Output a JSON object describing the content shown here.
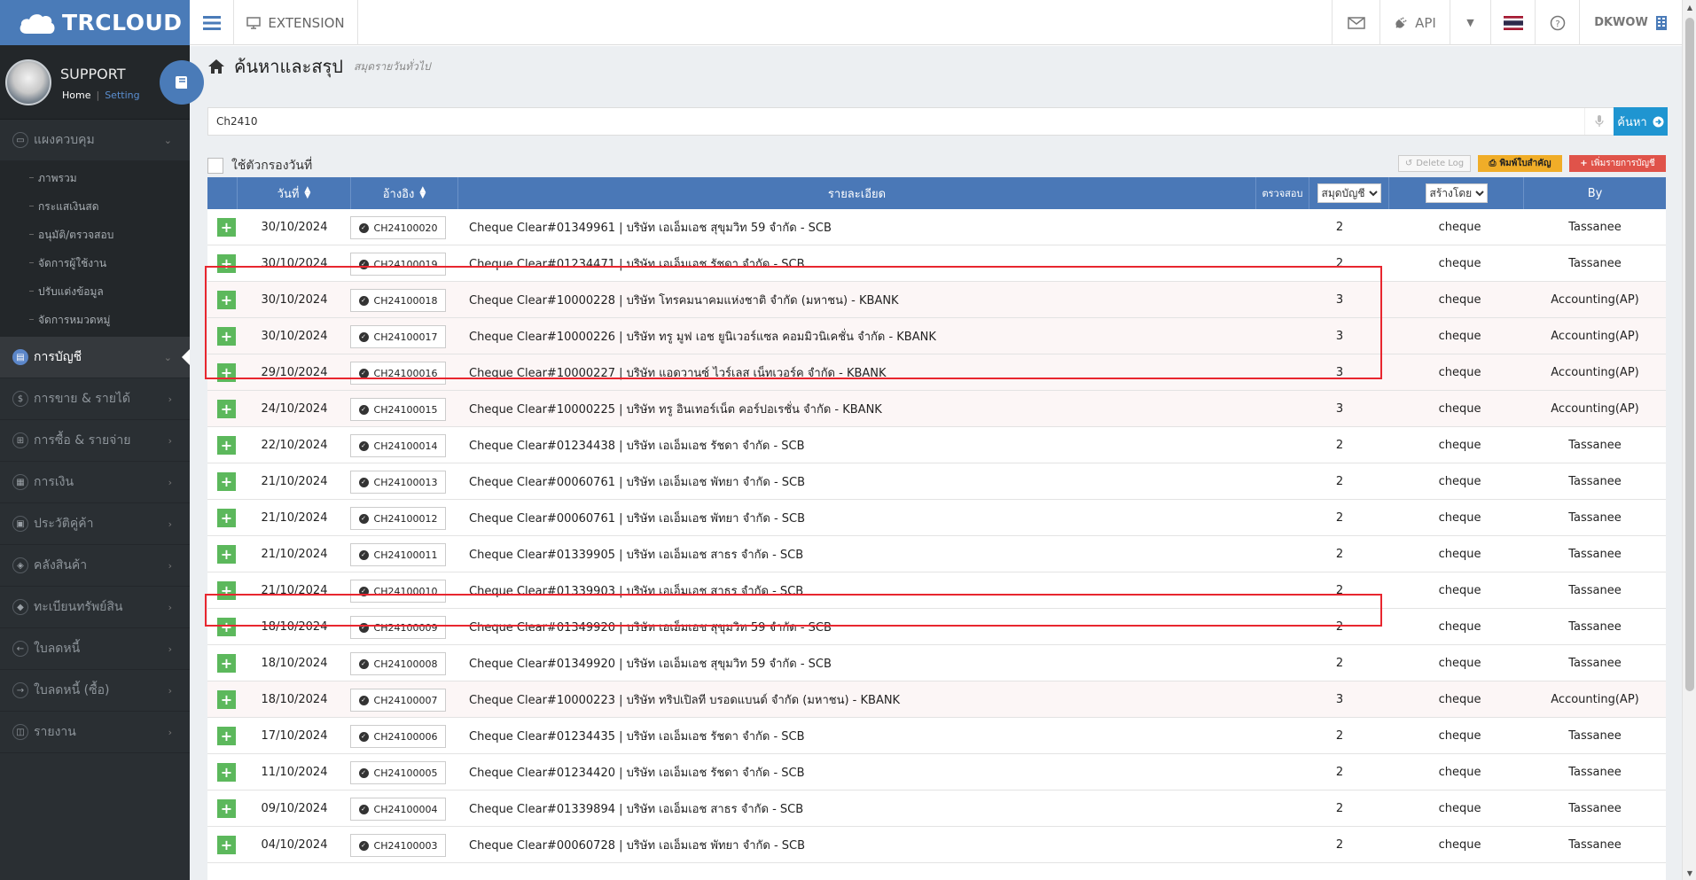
{
  "brand": {
    "name": "TRCLOUD"
  },
  "user": {
    "name": "SUPPORT",
    "home_link": "Home",
    "separator": "|",
    "setting_link": "Setting"
  },
  "topbar": {
    "extension_label": "EXTENSION",
    "api_label": "API",
    "company": "DKWOW"
  },
  "sidebar": {
    "dashboard": {
      "label": "แผงควบคุม",
      "sub": [
        "ภาพรวม",
        "กระแสเงินสด",
        "อนุมัติ/ตรวจสอบ",
        "จัดการผู้ใช้งาน",
        "ปรับแต่งข้อมูล",
        "จัดการหมวดหมู่"
      ]
    },
    "items": [
      {
        "label": "การบัญชี",
        "icon": "book-icon"
      },
      {
        "label": "การขาย & รายได้",
        "icon": "dollar-icon"
      },
      {
        "label": "การซื้อ & รายจ่าย",
        "icon": "cart-icon"
      },
      {
        "label": "การเงิน",
        "icon": "calendar-icon"
      },
      {
        "label": "ประวัติคู่ค้า",
        "icon": "contact-icon"
      },
      {
        "label": "คลังสินค้า",
        "icon": "boxes-icon"
      },
      {
        "label": "ทะเบียนทรัพย์สิน",
        "icon": "diamond-icon"
      },
      {
        "label": "ใบลดหนี้",
        "icon": "arrow-left-icon"
      },
      {
        "label": "ใบลดหนี้ (ซื้อ)",
        "icon": "arrow-right-icon"
      },
      {
        "label": "รายงาน",
        "icon": "report-icon"
      }
    ]
  },
  "page": {
    "title": "ค้นหาและสรุป",
    "subtitle": "สมุดรายวันทั่วไป"
  },
  "search": {
    "value": "Ch2410",
    "button": "ค้นหา"
  },
  "filter": {
    "label": "ใช้ตัวกรองวันที่"
  },
  "actions": {
    "delete_log": "Delete Log",
    "print": "พิมพ์ใบสำคัญ",
    "add": "เพิ่มรายการบัญชี"
  },
  "table": {
    "headers": {
      "date": "วันที่",
      "ref": "อ้างอิง",
      "detail": "รายละเอียด",
      "check": "ตรวจสอบ",
      "book_select": "สมุดบัญชี",
      "creator_select": "สร้างโดย",
      "by": "By"
    },
    "rows": [
      {
        "date": "30/10/2024",
        "ref": "CH24100020",
        "detail": "Cheque Clear#01349961 | บริษัท เอเอ็มเอช สุขุมวิท 59 จำกัด - SCB",
        "num": "2",
        "type": "cheque",
        "by": "Tassanee"
      },
      {
        "date": "30/10/2024",
        "ref": "CH24100019",
        "detail": "Cheque Clear#01234471 | บริษัท เอเอ็มเอช รัชดา จำกัด - SCB",
        "num": "2",
        "type": "cheque",
        "by": "Tassanee"
      },
      {
        "date": "30/10/2024",
        "ref": "CH24100018",
        "detail": "Cheque Clear#10000228 | บริษัท โทรคมนาคมแห่งชาติ จำกัด (มหาชน) - KBANK",
        "num": "3",
        "type": "cheque",
        "by": "Accounting(AP)"
      },
      {
        "date": "30/10/2024",
        "ref": "CH24100017",
        "detail": "Cheque Clear#10000226 | บริษัท ทรู มูฟ เอช ยูนิเวอร์แซล คอมมิวนิเคชั่น จำกัด - KBANK",
        "num": "3",
        "type": "cheque",
        "by": "Accounting(AP)"
      },
      {
        "date": "29/10/2024",
        "ref": "CH24100016",
        "detail": "Cheque Clear#10000227 | บริษัท แอดวานซ์ ไวร์เลส เน็ทเวอร์ค จำกัด - KBANK",
        "num": "3",
        "type": "cheque",
        "by": "Accounting(AP)"
      },
      {
        "date": "24/10/2024",
        "ref": "CH24100015",
        "detail": "Cheque Clear#10000225 | บริษัท ทรู อินเทอร์เน็ต คอร์ปอเรชั่น จำกัด - KBANK",
        "num": "3",
        "type": "cheque",
        "by": "Accounting(AP)"
      },
      {
        "date": "22/10/2024",
        "ref": "CH24100014",
        "detail": "Cheque Clear#01234438 | บริษัท เอเอ็มเอช รัชดา จำกัด - SCB",
        "num": "2",
        "type": "cheque",
        "by": "Tassanee"
      },
      {
        "date": "21/10/2024",
        "ref": "CH24100013",
        "detail": "Cheque Clear#00060761 | บริษัท เอเอ็มเอช พัทยา จำกัด - SCB",
        "num": "2",
        "type": "cheque",
        "by": "Tassanee"
      },
      {
        "date": "21/10/2024",
        "ref": "CH24100012",
        "detail": "Cheque Clear#00060761 | บริษัท เอเอ็มเอช พัทยา จำกัด - SCB",
        "num": "2",
        "type": "cheque",
        "by": "Tassanee"
      },
      {
        "date": "21/10/2024",
        "ref": "CH24100011",
        "detail": "Cheque Clear#01339905 | บริษัท เอเอ็มเอช สาธร จำกัด - SCB",
        "num": "2",
        "type": "cheque",
        "by": "Tassanee"
      },
      {
        "date": "21/10/2024",
        "ref": "CH24100010",
        "detail": "Cheque Clear#01339903 | บริษัท เอเอ็มเอช สาธร จำกัด - SCB",
        "num": "2",
        "type": "cheque",
        "by": "Tassanee"
      },
      {
        "date": "18/10/2024",
        "ref": "CH24100009",
        "detail": "Cheque Clear#01349920 | บริษัท เอเอ็มเอช สุขุมวิท 59 จำกัด - SCB",
        "num": "2",
        "type": "cheque",
        "by": "Tassanee"
      },
      {
        "date": "18/10/2024",
        "ref": "CH24100008",
        "detail": "Cheque Clear#01349920 | บริษัท เอเอ็มเอช สุขุมวิท 59 จำกัด - SCB",
        "num": "2",
        "type": "cheque",
        "by": "Tassanee"
      },
      {
        "date": "18/10/2024",
        "ref": "CH24100007",
        "detail": "Cheque Clear#10000223 | บริษัท ทริปเปิลที บรอดแบนด์ จำกัด (มหาชน) - KBANK",
        "num": "3",
        "type": "cheque",
        "by": "Accounting(AP)"
      },
      {
        "date": "17/10/2024",
        "ref": "CH24100006",
        "detail": "Cheque Clear#01234435 | บริษัท เอเอ็มเอช รัชดา จำกัด - SCB",
        "num": "2",
        "type": "cheque",
        "by": "Tassanee"
      },
      {
        "date": "11/10/2024",
        "ref": "CH24100005",
        "detail": "Cheque Clear#01234420 | บริษัท เอเอ็มเอช รัชดา จำกัด - SCB",
        "num": "2",
        "type": "cheque",
        "by": "Tassanee"
      },
      {
        "date": "09/10/2024",
        "ref": "CH24100004",
        "detail": "Cheque Clear#01339894 | บริษัท เอเอ็มเอช สาธร จำกัด - SCB",
        "num": "2",
        "type": "cheque",
        "by": "Tassanee"
      },
      {
        "date": "04/10/2024",
        "ref": "CH24100003",
        "detail": "Cheque Clear#00060728 | บริษัท เอเอ็มเอช พัทยา จำกัด - SCB",
        "num": "2",
        "type": "cheque",
        "by": "Tassanee"
      }
    ]
  },
  "colors": {
    "sidebar": "#2a2f33",
    "brand_blue": "#4a7bb8",
    "table_header": "#4a78b7",
    "add_green": "#5cb85c",
    "highlight_red": "#e8262f",
    "search_blue": "#1f95d1"
  }
}
